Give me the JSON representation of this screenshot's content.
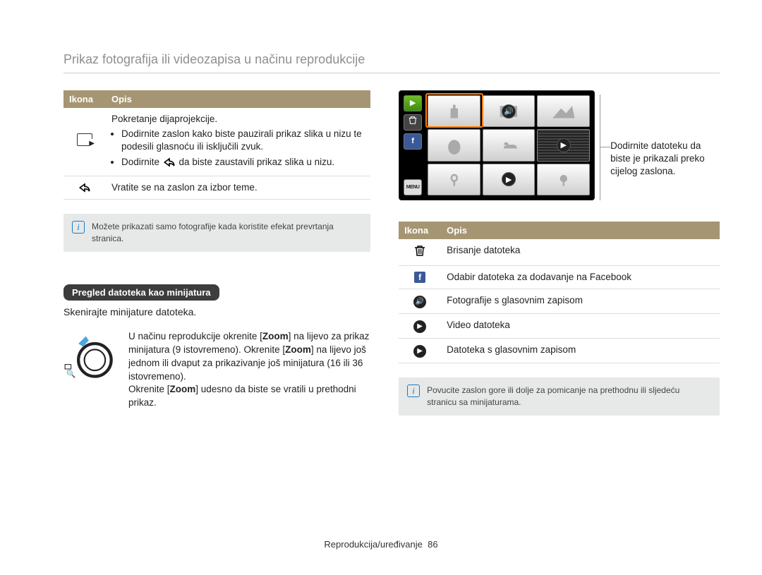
{
  "page_title": "Prikaz fotografija ili videozapisa u načinu reprodukcije",
  "table_headers": {
    "icon": "Ikona",
    "desc": "Opis"
  },
  "left_table": {
    "row1": {
      "title": "Pokretanje dijaprojekcije.",
      "b1": "Dodirnite zaslon kako biste pauzirali prikaz slika u nizu te podesili glasnoću ili isključili zvuk.",
      "b2a": "Dodirnite ",
      "b2b": " da biste zaustavili prikaz slika u nizu."
    },
    "row2": "Vratite se na zaslon za izbor teme."
  },
  "left_info": "Možete prikazati samo fotografije kada koristite efekat prevrtanja stranica.",
  "subhead": "Pregled datoteka kao minijatura",
  "subhead_after": "Skenirajte minijature datoteka.",
  "zoom_paragraph": {
    "p1a": "U načinu reprodukcije okrenite [",
    "zoom1": "Zoom",
    "p1b": "] na lijevo za prikaz minijatura (9 istovremeno). Okrenite [",
    "zoom2": "Zoom",
    "p1c": "] na lijevo još jednom ili dvaput za prikazivanje još minijatura (16 ili 36 istovremeno).",
    "p2a": "Okrenite [",
    "zoom3": "Zoom",
    "p2b": "] udesno da biste se vratili u prethodni prikaz."
  },
  "callout": "Dodirnite datoteku da biste je prikazali preko cijelog zaslona.",
  "right_table": {
    "r1": "Brisanje datoteka",
    "r2": "Odabir datoteka za dodavanje na Facebook",
    "r3": "Fotografije s glasovnim zapisom",
    "r4": "Video datoteka",
    "r5": "Datoteka s glasovnim zapisom"
  },
  "right_info": "Povucite zaslon gore ili dolje za pomicanje na prethodnu ili sljedeću stranicu sa minijaturama.",
  "cam_menu_label": "MENU",
  "footer": {
    "section": "Reprodukcija/uređivanje",
    "page": "86"
  }
}
